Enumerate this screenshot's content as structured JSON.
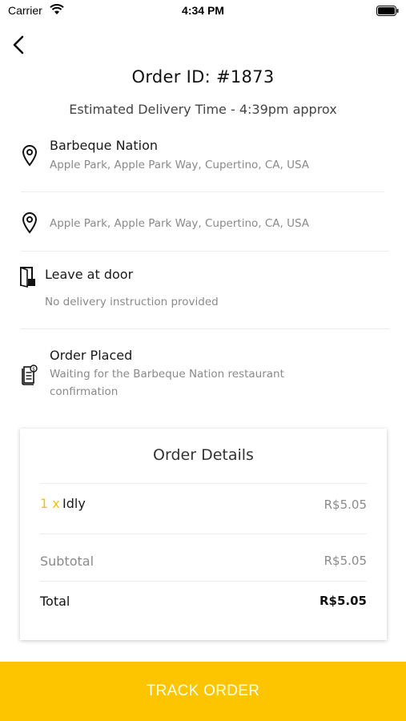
{
  "status_bar": {
    "carrier": "Carrier",
    "time": "4:34 PM"
  },
  "header": {
    "title": "Order ID: #1873",
    "eta": "Estimated Delivery Time - 4:39pm approx"
  },
  "restaurant": {
    "name": "Barbeque Nation",
    "address": "Apple Park, Apple Park Way, Cupertino, CA, USA",
    "icon": "location-pin-icon"
  },
  "delivery": {
    "address": "Apple Park, Apple Park Way, Cupertino, CA, USA",
    "icon": "location-pin-icon"
  },
  "instructions": {
    "title": "Leave at door",
    "note": "No delivery instruction provided",
    "icon": "door-icon"
  },
  "order_status": {
    "title": "Order Placed",
    "note": "Waiting for the Barbeque Nation restaurant confirmation",
    "icon": "receipt-icon"
  },
  "order_details": {
    "title": "Order Details",
    "items": [
      {
        "qty": "1 x",
        "name": "Idly",
        "price": "R$5.05"
      }
    ],
    "subtotal_label": "Subtotal",
    "subtotal_value": "R$5.05",
    "total_label": "Total",
    "total_value": "R$5.05"
  },
  "actions": {
    "track_label": "TRACK ORDER"
  },
  "colors": {
    "accent": "#fcc500",
    "qty": "#f7c300",
    "muted_text": "#8a8a8a"
  }
}
